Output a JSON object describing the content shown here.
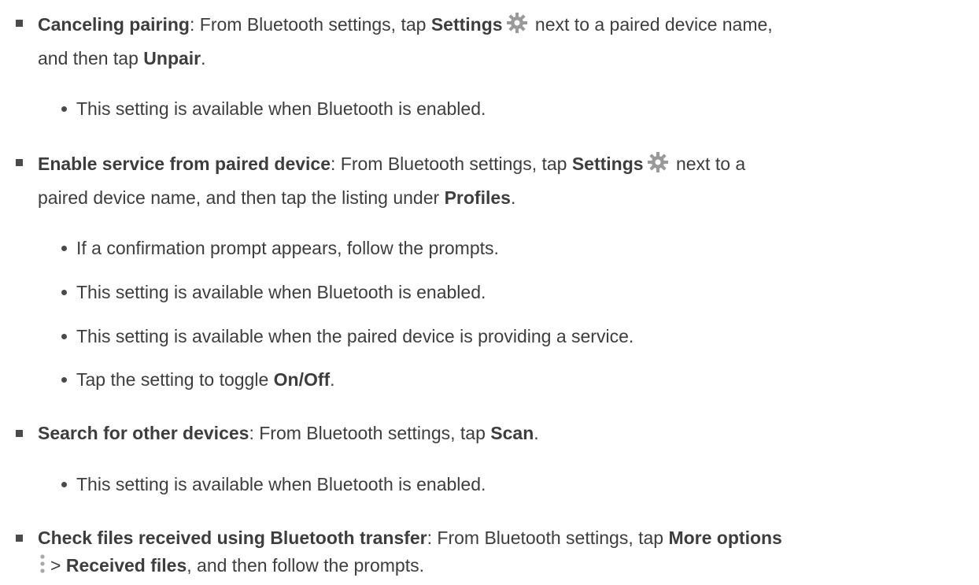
{
  "items": [
    {
      "title": "Canceling pairing",
      "text1": ": From Bluetooth settings, tap ",
      "bold1": "Settings",
      "text2": " next to a paired device name,",
      "line2_text1": "and then tap ",
      "line2_bold": "Unpair",
      "line2_text2": ".",
      "subs": [
        "This setting is available when Bluetooth is enabled."
      ]
    },
    {
      "title": "Enable service from paired device",
      "text1": ": From Bluetooth settings, tap ",
      "bold1": "Settings",
      "text2": " next to a",
      "line2_text1": "paired device name, and then tap the listing under ",
      "line2_bold": "Profiles",
      "line2_text2": ".",
      "subs": [
        "If a confirmation prompt appears, follow the prompts.",
        "This setting is available when Bluetooth is enabled.",
        "This setting is available when the paired device is providing a service.",
        "Tap the setting to toggle "
      ],
      "sub_bold": "On/Off",
      "sub_bold_after": "."
    },
    {
      "title": "Search for other devices",
      "text1": ": From Bluetooth settings, tap ",
      "bold1": "Scan",
      "text2": ".",
      "subs": [
        "This setting is available when Bluetooth is enabled."
      ]
    },
    {
      "title": "Check files received using Bluetooth transfer",
      "text1": ": From Bluetooth settings, tap ",
      "bold1": "More options",
      "line2_sep": "> ",
      "line2_bold": "Received files",
      "line2_text2": ", and then follow the prompts."
    }
  ],
  "icons": {
    "settings": "gear-icon",
    "more_options": "more-options-icon"
  }
}
